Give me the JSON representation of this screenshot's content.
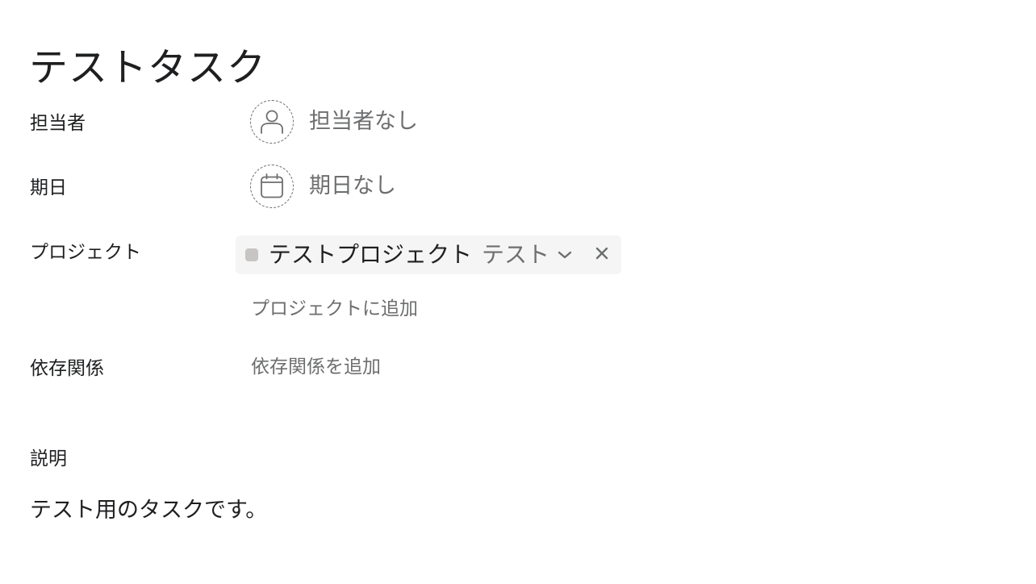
{
  "task": {
    "title": "テストタスク"
  },
  "fields": {
    "assignee": {
      "label": "担当者",
      "value": "担当者なし",
      "icon": "user-icon"
    },
    "due_date": {
      "label": "期日",
      "value": "期日なし",
      "icon": "calendar-icon"
    },
    "projects": {
      "label": "プロジェクト",
      "items": [
        {
          "name": "テストプロジェクト",
          "section": "テスト",
          "color": "#c7c4c4"
        }
      ],
      "add_label": "プロジェクトに追加"
    },
    "dependencies": {
      "label": "依存関係",
      "add_label": "依存関係を追加"
    }
  },
  "description": {
    "label": "説明",
    "text": "テスト用のタスクです。"
  },
  "colors": {
    "text_primary": "#1e1f21",
    "text_secondary": "#6d6e6f",
    "pill_background": "#f5f5f5"
  }
}
